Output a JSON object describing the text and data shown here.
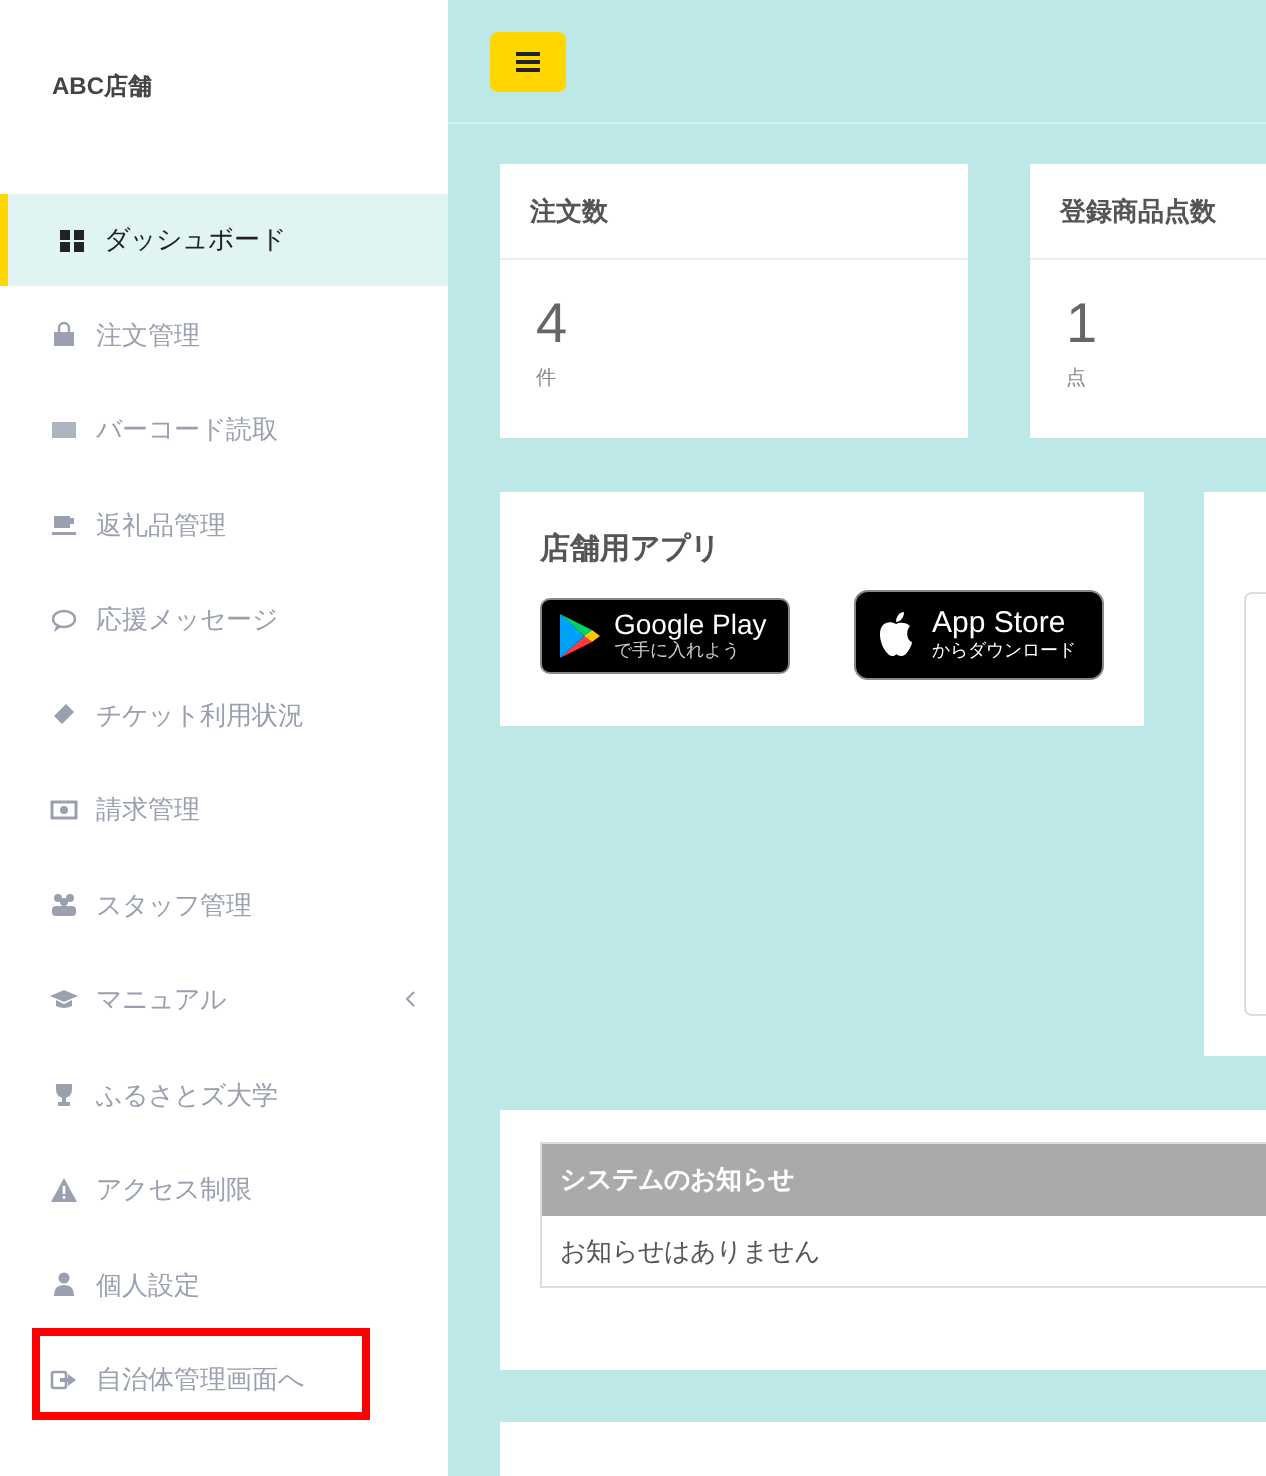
{
  "sidebar": {
    "brand": "ABC店舗",
    "items": [
      {
        "label": "ダッシュボード",
        "selected": true,
        "submenu": false,
        "highlighted": false
      },
      {
        "label": "注文管理",
        "selected": false,
        "submenu": false,
        "highlighted": false
      },
      {
        "label": "バーコード読取",
        "selected": false,
        "submenu": false,
        "highlighted": false
      },
      {
        "label": "返礼品管理",
        "selected": false,
        "submenu": false,
        "highlighted": false
      },
      {
        "label": "応援メッセージ",
        "selected": false,
        "submenu": false,
        "highlighted": false
      },
      {
        "label": "チケット利用状況",
        "selected": false,
        "submenu": false,
        "highlighted": false
      },
      {
        "label": "請求管理",
        "selected": false,
        "submenu": false,
        "highlighted": false
      },
      {
        "label": "スタッフ管理",
        "selected": false,
        "submenu": false,
        "highlighted": false
      },
      {
        "label": "マニュアル",
        "selected": false,
        "submenu": true,
        "highlighted": false
      },
      {
        "label": "ふるさとズ大学",
        "selected": false,
        "submenu": false,
        "highlighted": false
      },
      {
        "label": "アクセス制限",
        "selected": false,
        "submenu": false,
        "highlighted": false
      },
      {
        "label": "個人設定",
        "selected": false,
        "submenu": false,
        "highlighted": false
      },
      {
        "label": "自治体管理画面へ",
        "selected": false,
        "submenu": false,
        "highlighted": true
      }
    ]
  },
  "stats": [
    {
      "title": "注文数",
      "value": "4",
      "unit": "件"
    },
    {
      "title": "登録商品点数",
      "value": "1",
      "unit": "点"
    }
  ],
  "app_card": {
    "title": "店舗用アプリ",
    "google_play": {
      "name": "Google Play",
      "caption": "で手に入れよう"
    },
    "app_store": {
      "name": "App Store",
      "caption": "からダウンロード"
    }
  },
  "system_notices": {
    "header": "システムのお知らせ",
    "empty_text": "お知らせはありません"
  }
}
